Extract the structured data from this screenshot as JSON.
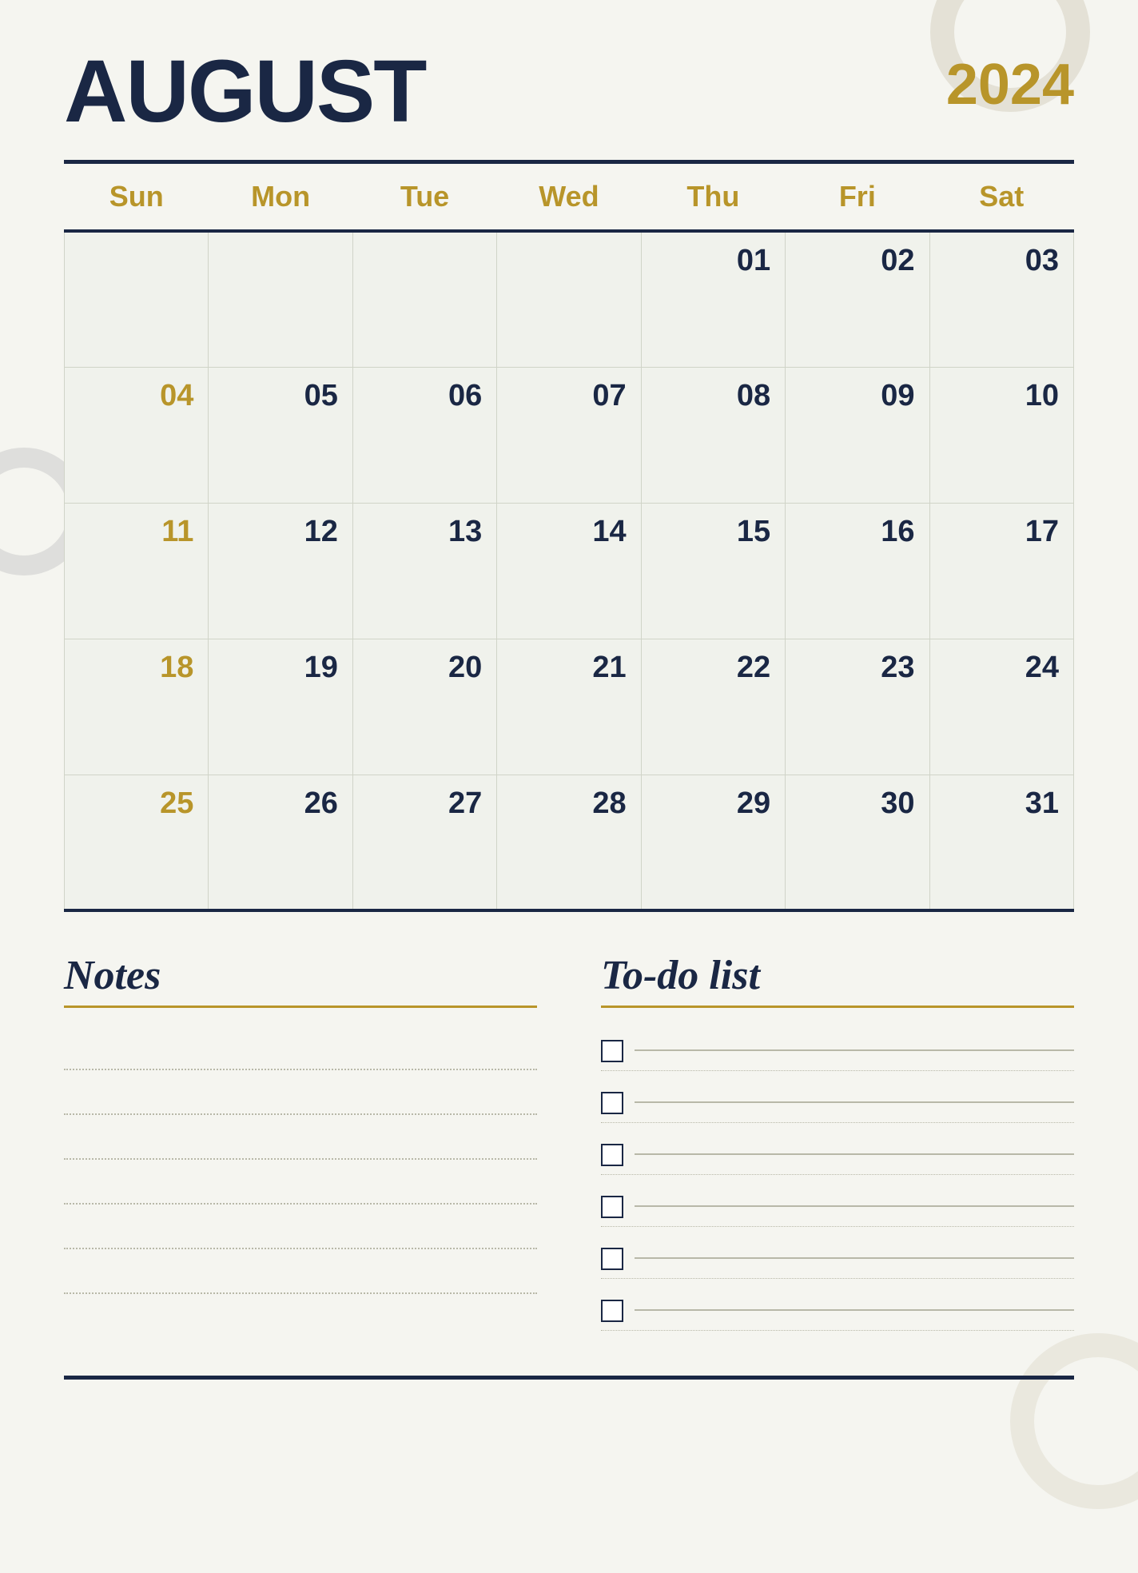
{
  "header": {
    "month": "AUGUST",
    "year": "2024"
  },
  "calendar": {
    "days_of_week": [
      "Sun",
      "Mon",
      "Tue",
      "Wed",
      "Thu",
      "Fri",
      "Sat"
    ],
    "weeks": [
      [
        "",
        "",
        "",
        "",
        "01",
        "02",
        "03"
      ],
      [
        "04",
        "05",
        "06",
        "07",
        "08",
        "09",
        "10"
      ],
      [
        "11",
        "12",
        "13",
        "14",
        "15",
        "16",
        "17"
      ],
      [
        "18",
        "19",
        "20",
        "21",
        "22",
        "23",
        "24"
      ],
      [
        "25",
        "26",
        "27",
        "28",
        "29",
        "30",
        "31"
      ]
    ]
  },
  "notes": {
    "title": "Notes",
    "lines": 6
  },
  "todo": {
    "title": "To-do list",
    "items": 6
  },
  "colors": {
    "navy": "#1a2744",
    "gold": "#b8952a",
    "bg": "#f5f5f0",
    "cell_bg": "#f0f2ec"
  }
}
